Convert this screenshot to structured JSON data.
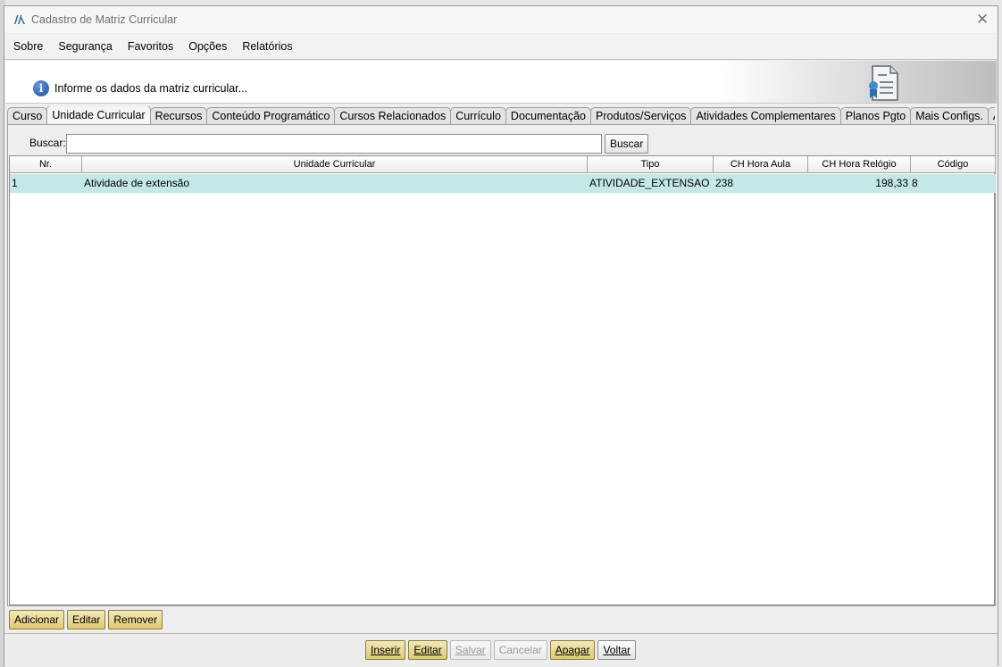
{
  "window": {
    "title": "Cadastro de Matriz Curricular"
  },
  "menu": [
    {
      "label": "Sobre"
    },
    {
      "label": "Segurança"
    },
    {
      "label": "Favoritos"
    },
    {
      "label": "Opções"
    },
    {
      "label": "Relatórios"
    }
  ],
  "banner": {
    "info_text": "Informe os dados da matriz curricular..."
  },
  "tabs": [
    {
      "label": "Curso"
    },
    {
      "label": "Unidade Curricular",
      "active": true
    },
    {
      "label": "Recursos"
    },
    {
      "label": "Conteúdo Programático"
    },
    {
      "label": "Cursos Relacionados"
    },
    {
      "label": "Currículo"
    },
    {
      "label": "Documentação"
    },
    {
      "label": "Produtos/Serviços"
    },
    {
      "label": "Atividades Complementares"
    },
    {
      "label": "Planos Pgto"
    },
    {
      "label": "Mais Configs."
    },
    {
      "label": "AvaliA"
    }
  ],
  "search": {
    "label": "Buscar:",
    "value": "",
    "button": "Buscar"
  },
  "table": {
    "columns": [
      "Nr.",
      "Unidade Curricular",
      "Tipo",
      "CH Hora Aula",
      "CH Hora Relógio",
      "Código"
    ],
    "rows": [
      {
        "nr": "1",
        "unidade": "Atividade de extensão",
        "tipo": "ATIVIDADE_EXTENSAO",
        "ch_aula": "238",
        "ch_relogio": "198,33",
        "codigo": "8"
      }
    ]
  },
  "panel_buttons": {
    "adicionar": "Adicionar",
    "editar": "Editar",
    "remover": "Remover"
  },
  "bottom_buttons": {
    "inserir": "Inserir",
    "editar": "Editar",
    "salvar": "Salvar",
    "cancelar": "Cancelar",
    "apagar": "Apagar",
    "voltar": "Voltar"
  },
  "colors": {
    "selected_row": "#c4e8e6",
    "action_button": "#e8dc93"
  },
  "icons": {
    "app": "app-logo-icon",
    "close": "close-icon",
    "info": "info-icon",
    "doc": "certificate-document-icon"
  }
}
